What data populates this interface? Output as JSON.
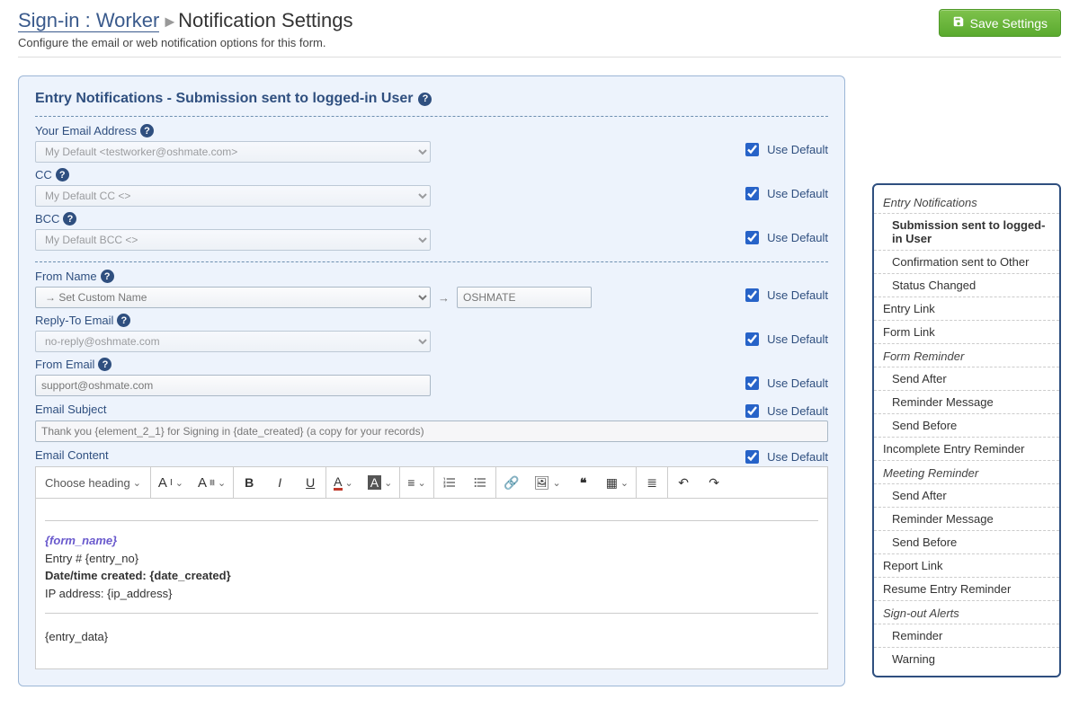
{
  "header": {
    "breadcrumb_link": "Sign-in : Worker",
    "page_title": "Notification Settings",
    "subtitle": "Configure the email or web notification options for this form.",
    "save_button": "Save Settings"
  },
  "panel": {
    "title": "Entry Notifications - Submission sent to logged-in User",
    "use_default_label": "Use Default"
  },
  "fields": {
    "email": {
      "label": "Your Email Address",
      "value": "My Default <testworker@oshmate.com>"
    },
    "cc": {
      "label": "CC",
      "value": "My Default CC <>"
    },
    "bcc": {
      "label": "BCC",
      "value": "My Default BCC <>"
    },
    "from_name": {
      "label": "From Name",
      "select_value": "→ Set Custom Name",
      "text_value": "OSHMATE"
    },
    "reply_to": {
      "label": "Reply-To Email",
      "value": "no-reply@oshmate.com"
    },
    "from_email": {
      "label": "From Email",
      "value": "support@oshmate.com"
    },
    "subject": {
      "label": "Email Subject",
      "value": "Thank you {element_2_1} for Signing in {date_created} (a copy for your records)"
    },
    "content": {
      "label": "Email Content"
    }
  },
  "editor": {
    "heading_label": "Choose heading",
    "body": {
      "form_name": "{form_name}",
      "l1_prefix": "Entry # ",
      "l1_value": "{entry_no}",
      "l2_prefix": "Date/time created: ",
      "l2_value": "{date_created}",
      "l3_prefix": "IP address: ",
      "l3_value": "{ip_address}",
      "l4": "{entry_data}"
    }
  },
  "sidebar": {
    "s1": "Entry Notifications",
    "s1_items": [
      "Submission sent to logged-in User",
      "Confirmation sent to Other",
      "Status Changed"
    ],
    "top_items": [
      "Entry Link",
      "Form Link"
    ],
    "s2": "Form Reminder",
    "s2_items": [
      "Send After",
      "Reminder Message",
      "Send Before"
    ],
    "mid_items": [
      "Incomplete Entry Reminder"
    ],
    "s3": "Meeting Reminder",
    "s3_items": [
      "Send After",
      "Reminder Message",
      "Send Before"
    ],
    "bottom_items": [
      "Report Link",
      "Resume Entry Reminder"
    ],
    "s4": "Sign-out Alerts",
    "s4_items": [
      "Reminder",
      "Warning"
    ]
  }
}
